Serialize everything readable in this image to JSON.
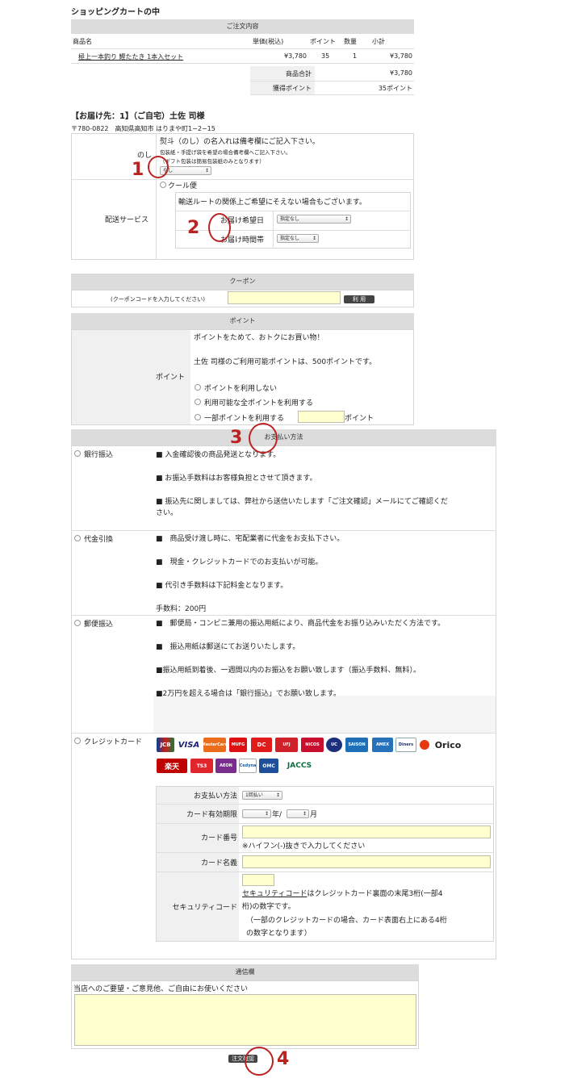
{
  "page_title": "ショッピングカートの中",
  "order": {
    "header": "ご注文内容",
    "columns": [
      "商品名",
      "単価(税込)",
      "ポイント",
      "数量",
      "小計"
    ],
    "item": {
      "name": "極上一本釣り 鰹たたき 1本入セット",
      "price": "¥3,780",
      "points": "35",
      "qty": "1",
      "subtotal": "¥3,780"
    },
    "total_label": "商品合計",
    "total_value": "¥3,780",
    "points_label": "獲得ポイント",
    "points_value": "35ポイント"
  },
  "delivery": {
    "title": "【お届け先：1】（ご自宅）土佐 司様",
    "address": "〒780-0822　高知県高知市 はりまや町1−2−15",
    "noshi_label": "のし",
    "noshi_note1": "熨斗（のし）の名入れは備考欄にご記入下さい。",
    "noshi_note2": "包装紙・手提げ袋を希望の場合備考欄へご記入下さい。",
    "noshi_note3": "（ギフト包装は簡易包装紙のみとなります）",
    "noshi_select": "なし",
    "service_label": "配送サービス",
    "cool": "クール便",
    "route_note": "輸送ルートの関係上ご希望にそえない場合もございます。",
    "date_label": "お届け希望日",
    "date_select": "指定なし",
    "time_label": "お届け時間帯",
    "time_select": "指定なし"
  },
  "coupon": {
    "header": "クーポン",
    "prompt": "(クーポンコードを入力してください)",
    "button": "利 用"
  },
  "points": {
    "header": "ポイント",
    "label": "ポイント",
    "intro": "ポイントをためて、おトクにお買い物！",
    "available": "土佐 司様のご利用可能ポイントは、500ポイントです。",
    "opt1": "ポイントを利用しない",
    "opt2": "利用可能な全ポイントを利用する",
    "opt3": "一部ポイントを利用する",
    "unit": "ポイント"
  },
  "payment": {
    "header": "お支払い方法",
    "bank": {
      "label": "銀行振込",
      "l1": "■ 入金確認後の商品発送となります。",
      "l2": "■ お振込手数料はお客様負担とさせて頂きます。",
      "l3": "■ 振込先に関しましては、弊社から送信いたします「ご注文確認」メールにてご確認くだ",
      "l3b": "さい。"
    },
    "cod": {
      "label": "代金引換",
      "l1": "■　商品受け渡し時に、宅配業者に代金をお支払下さい。",
      "l2": "■　現金・クレジットカードでのお支払いが可能。",
      "l3": "■ 代引き手数料は下記料金となります。",
      "l4": "手数料：200円"
    },
    "postal": {
      "label": "郵便振込",
      "l1": "■　郵便局・コンビニ兼用の振込用紙により、商品代金をお振り込みいただく方法です。",
      "l2": "■　振込用紙は郵送にてお送りいたします。",
      "l3": "■振込用紙到着後、一週間以内のお振込をお願い致します（振込手数料、無料）。",
      "l4": "■2万円を超える場合は「銀行振込」でお願い致します。"
    },
    "credit": {
      "label": "クレジットカード",
      "logos": [
        "JCB",
        "VISA",
        "MasterCard",
        "MUFG",
        "DC",
        "UFJ",
        "NICOS",
        "UC",
        "SAISON",
        "AMEX",
        "Diners",
        "Orico",
        "楽天",
        "TS3",
        "AEON",
        "Cedyna",
        "OMC",
        "JACCS"
      ],
      "method_label": "お支払い方法",
      "method_select": "1回払い",
      "expiry_label": "カード有効期限",
      "year": "年/",
      "month": "月",
      "number_label": "カード番号",
      "number_note": "※ハイフン(-)抜きで入力してください",
      "name_label": "カード名義",
      "cvv_label": "セキュリティコード",
      "cvv_link": "セキュリティコード",
      "cvv_n1": "はクレジットカード裏面の末尾3桁(一部4",
      "cvv_n2": "桁)の数字です。",
      "cvv_n3": "（一部のクレジットカードの場合、カード表面右上にある4桁",
      "cvv_n4": "の数字となります）"
    }
  },
  "message": {
    "header": "通信欄",
    "prompt": "当店へのご要望・ご意見他、ご自由にお使いください"
  },
  "confirm_button": "注文確認",
  "markers": [
    "1",
    "2",
    "3",
    "4"
  ],
  "colors": {
    "marker": "#b22222",
    "header_bg": "#dcdcdc",
    "input_bg": "#ffffd0"
  }
}
